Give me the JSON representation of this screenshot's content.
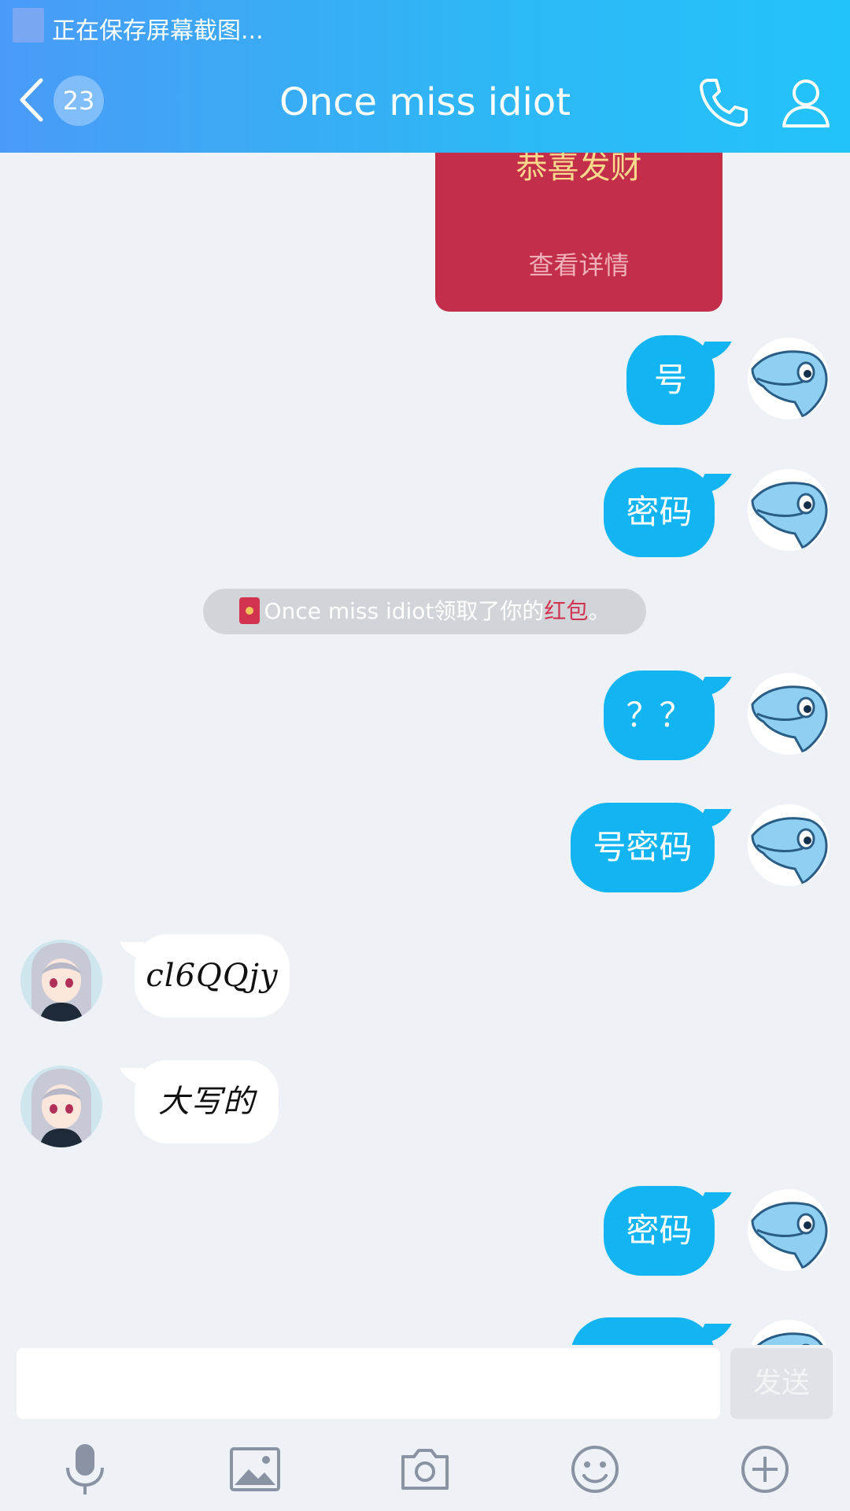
{
  "status_bar": {
    "text": "正在保存屏幕截图..."
  },
  "header": {
    "unread_count": "23",
    "title": "Once miss idiot"
  },
  "red_packet": {
    "greeting": "恭喜发财",
    "detail_link": "查看详情"
  },
  "messages": [
    {
      "from": "self",
      "text": "号"
    },
    {
      "from": "self",
      "text": "密码"
    },
    {
      "from": "self",
      "text": "？？"
    },
    {
      "from": "self",
      "text": "号密码"
    },
    {
      "from": "peer",
      "text": "cl6QQjy"
    },
    {
      "from": "peer",
      "text": "大写的"
    },
    {
      "from": "self",
      "text": "密码"
    },
    {
      "from": "self",
      "text": ""
    }
  ],
  "system_note": {
    "prefix": "Once miss idiot领取了你的",
    "highlight": "红包",
    "suffix": "。"
  },
  "input": {
    "placeholder": "",
    "send_label": "发送"
  },
  "toolbar": [
    "microphone-icon",
    "image-icon",
    "camera-icon",
    "emoji-icon",
    "plus-icon"
  ],
  "colors": {
    "header_start": "#4a9bf7",
    "header_end": "#22c3fb",
    "bubble_self": "#12b4f2",
    "red_packet": "#c32f4b",
    "highlight": "#d2334f"
  }
}
